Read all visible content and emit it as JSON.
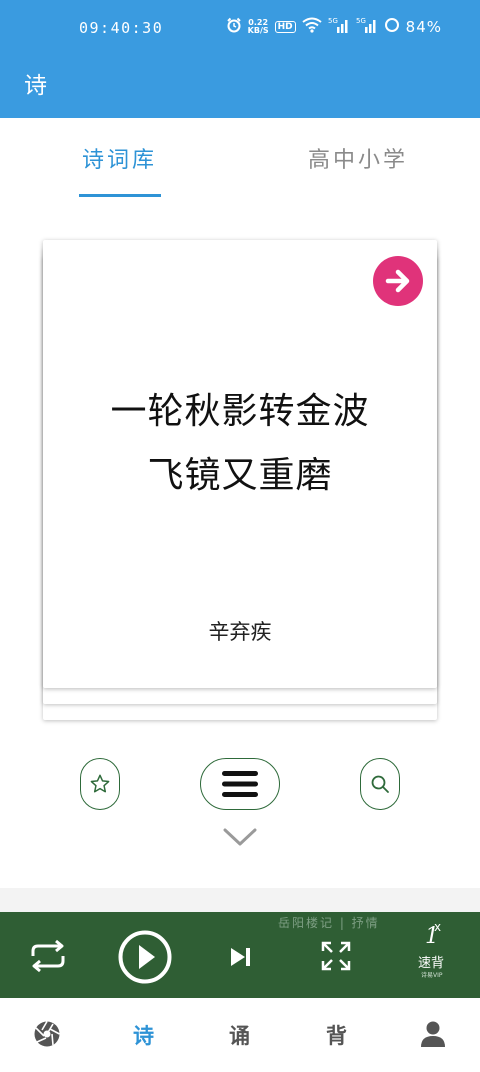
{
  "status_bar": {
    "time": "09:40:30",
    "net_speed_value": "0.22",
    "net_speed_unit": "KB/S",
    "hd_label": "HD",
    "signal1": "5G",
    "signal2": "5G",
    "battery": "84%"
  },
  "app_bar": {
    "title": "诗"
  },
  "tabs": [
    {
      "label": "诗词库",
      "active": true
    },
    {
      "label": "高中小学",
      "active": false
    }
  ],
  "card": {
    "lines": [
      "一轮秋影转金波",
      "飞镜又重磨"
    ],
    "author": "辛弃疾"
  },
  "player": {
    "track": "岳阳楼记 | 抒情",
    "speed_value": "1",
    "speed_unit": "x",
    "speed_label": "速背",
    "speed_sub": "诗易VIP"
  },
  "bottom_nav": [
    {
      "label": "",
      "icon": "aperture-icon"
    },
    {
      "label": "诗",
      "active": true
    },
    {
      "label": "诵"
    },
    {
      "label": "背"
    },
    {
      "label": "",
      "icon": "user-icon"
    }
  ],
  "colors": {
    "primary": "#3a9be0",
    "accent": "#e0337a",
    "player_bg": "#2f5e34"
  }
}
